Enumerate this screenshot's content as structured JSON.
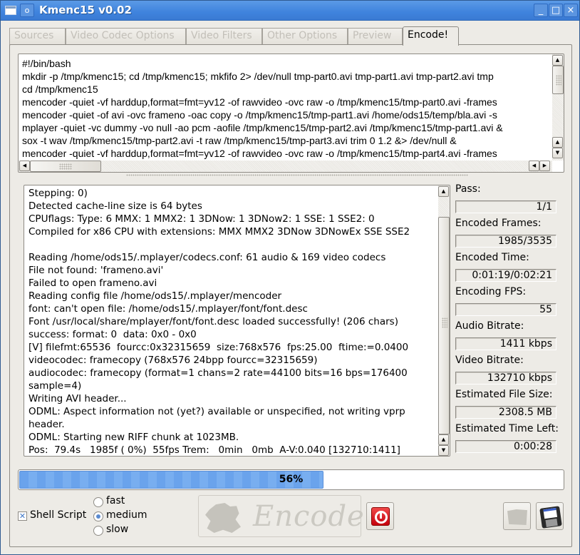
{
  "window": {
    "title": "Kmenc15 v0.02",
    "menu_glyph": "o",
    "minimize_glyph": "_",
    "maximize_glyph": "□",
    "close_glyph": "×"
  },
  "tabs": [
    {
      "label": "Sources",
      "active": false
    },
    {
      "label": "Video Codec Options",
      "active": false
    },
    {
      "label": "Video Filters",
      "active": false
    },
    {
      "label": "Other Options",
      "active": false
    },
    {
      "label": "Preview",
      "active": false
    },
    {
      "label": "Encode!",
      "active": true
    }
  ],
  "script": {
    "lines": [
      "#!/bin/bash",
      "mkdir -p /tmp/kmenc15; cd /tmp/kmenc15; mkfifo 2> /dev/null tmp-part0.avi tmp-part1.avi tmp-part2.avi tmp",
      "cd /tmp/kmenc15",
      "mencoder -quiet -vf harddup,format=fmt=yv12 -of rawvideo -ovc raw -o /tmp/kmenc15/tmp-part0.avi -frames",
      "mencoder -quiet -of avi -ovc frameno -oac copy -o /tmp/kmenc15/tmp-part1.avi /home/ods15/temp/bla.avi -s",
      "mplayer -quiet -vc dummy -vo null -ao pcm -aofile /tmp/kmenc15/tmp-part2.avi /tmp/kmenc15/tmp-part1.avi &",
      "sox -t wav /tmp/kmenc15/tmp-part2.avi -t raw /tmp/kmenc15/tmp-part3.avi trim 0 1.2 &> /dev/null &",
      "mencoder -quiet -vf harddup,format=fmt=yv12 -of rawvideo -ovc raw -o /tmp/kmenc15/tmp-part4.avi -frames"
    ]
  },
  "log": {
    "lines": [
      "Stepping: 0)",
      "Detected cache-line size is 64 bytes",
      "CPUflags: Type: 6 MMX: 1 MMX2: 1 3DNow: 1 3DNow2: 1 SSE: 1 SSE2: 0",
      "Compiled for x86 CPU with extensions: MMX MMX2 3DNow 3DNowEx SSE SSE2",
      "",
      "Reading /home/ods15/.mplayer/codecs.conf: 61 audio & 169 video codecs",
      "File not found: 'frameno.avi'",
      "Failed to open frameno.avi",
      "Reading config file /home/ods15/.mplayer/mencoder",
      "font: can't open file: /home/ods15/.mplayer/font/font.desc",
      "Font /usr/local/share/mplayer/font/font.desc loaded successfully! (206 chars)",
      "success: format: 0  data: 0x0 - 0x0",
      "[V] filefmt:65536  fourcc:0x32315659  size:768x576  fps:25.00  ftime:=0.0400",
      "videocodec: framecopy (768x576 24bpp fourcc=32315659)",
      "audiocodec: framecopy (format=1 chans=2 rate=44100 bits=16 bps=176400",
      "sample=4)",
      "Writing AVI header...",
      "ODML: Aspect information not (yet?) available or unspecified, not writing vprp",
      "header.",
      "ODML: Starting new RIFF chunk at 1023MB.",
      "Pos:  79.4s   1985f ( 0%)  55fps Trem:   0min   0mb  A-V:0.040 [132710:1411]"
    ]
  },
  "stats": [
    {
      "label": "Pass:",
      "value": "1/1"
    },
    {
      "label": "Encoded Frames:",
      "value": "1985/3535"
    },
    {
      "label": "Encoded Time:",
      "value": "0:01:19/0:02:21"
    },
    {
      "label": "Encoding FPS:",
      "value": "55"
    },
    {
      "label": "Audio Bitrate:",
      "value": "1411 kbps"
    },
    {
      "label": "Video Bitrate:",
      "value": "132710 kbps"
    },
    {
      "label": "Estimated File Size:",
      "value": "2308.5 MB"
    },
    {
      "label": "Estimated Time Left:",
      "value": "0:00:28"
    }
  ],
  "progress": {
    "percent": 56,
    "label": "56%"
  },
  "controls": {
    "shell_script_label": "Shell Script",
    "shell_script_checked": true,
    "check_glyph": "✕",
    "speed_options": [
      {
        "label": "fast",
        "checked": false
      },
      {
        "label": "medium",
        "checked": true
      },
      {
        "label": "slow",
        "checked": false
      }
    ],
    "encode_label": "Encode",
    "accent_color": "#6aa3ec",
    "stop_color": "#d9141e"
  }
}
